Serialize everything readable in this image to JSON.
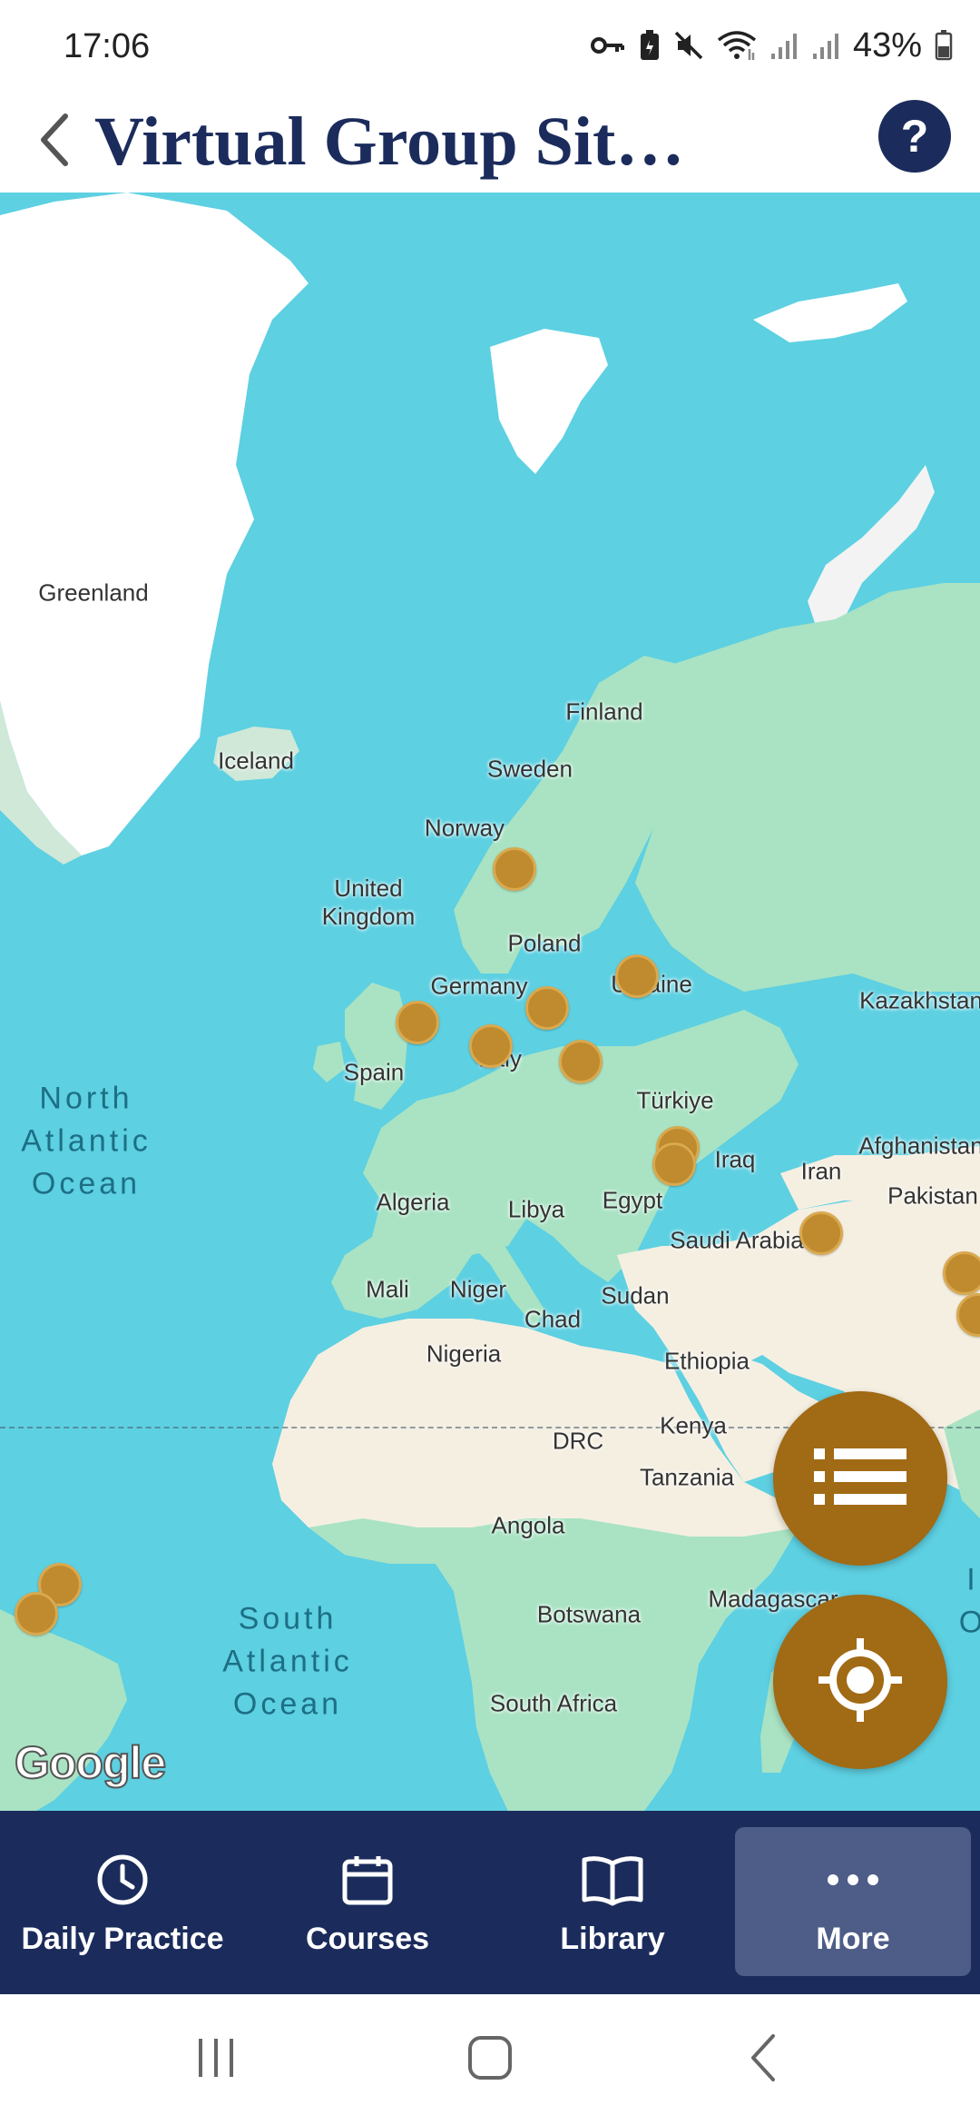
{
  "status_bar": {
    "time": "17:06",
    "battery": "43%",
    "icons": [
      "vpn-key-icon",
      "battery-saver-icon",
      "mute-icon",
      "wifi-icon",
      "signal-icon",
      "signal-icon",
      "battery-icon"
    ]
  },
  "header": {
    "title": "Virtual Group Sit…",
    "back_icon": "chevron-left-icon",
    "help_label": "?"
  },
  "map": {
    "attribution": "Google",
    "ocean_labels": {
      "north_atlantic": "North\nAtlantic\nOcean",
      "south_atlantic": "South\nAtlantic\nOcean"
    },
    "place_labels": {
      "greenland": "Greenland",
      "iceland": "Iceland",
      "finland": "Finland",
      "sweden": "Sweden",
      "norway": "Norway",
      "united_kingdom": "United\nKingdom",
      "poland": "Poland",
      "germany": "Germany",
      "ukraine": "Ukraine",
      "kazakhstan": "Kazakhstan",
      "spain": "Spain",
      "italy": "Italy",
      "turkiye": "Türkiye",
      "iraq": "Iraq",
      "iran": "Iran",
      "afghanistan": "Afghanistan",
      "pakistan": "Pakistan",
      "algeria": "Algeria",
      "libya": "Libya",
      "egypt": "Egypt",
      "saudi_arabia": "Saudi Arabia",
      "mali": "Mali",
      "niger": "Niger",
      "chad": "Chad",
      "sudan": "Sudan",
      "nigeria": "Nigeria",
      "ethiopia": "Ethiopia",
      "drc": "DRC",
      "kenya": "Kenya",
      "tanzania": "Tanzania",
      "angola": "Angola",
      "botswana": "Botswana",
      "madagascar": "Madagascar",
      "south_africa": "South Africa",
      "india_partial": "I",
      "ocean_partial": "O"
    },
    "marker_count": 14
  },
  "fabs": {
    "list_icon": "list-icon",
    "locate_icon": "my-location-icon"
  },
  "bottom_nav": {
    "items": [
      {
        "label": "Daily Practice",
        "icon": "clock-icon"
      },
      {
        "label": "Courses",
        "icon": "calendar-icon"
      },
      {
        "label": "Library",
        "icon": "book-icon"
      },
      {
        "label": "More",
        "icon": "more-dots-icon"
      }
    ],
    "active_index": 3
  },
  "system_nav": {
    "buttons": [
      "recent-apps-icon",
      "home-icon",
      "back-icon"
    ]
  },
  "colors": {
    "brand_navy": "#1b2c5c",
    "accent_gold": "#a16a14",
    "marker_gold": "#c08a2e",
    "ocean": "#5dd0e2",
    "land_green": "#a9e3c3",
    "land_sand": "#f5efe2",
    "ice": "#ffffff"
  }
}
